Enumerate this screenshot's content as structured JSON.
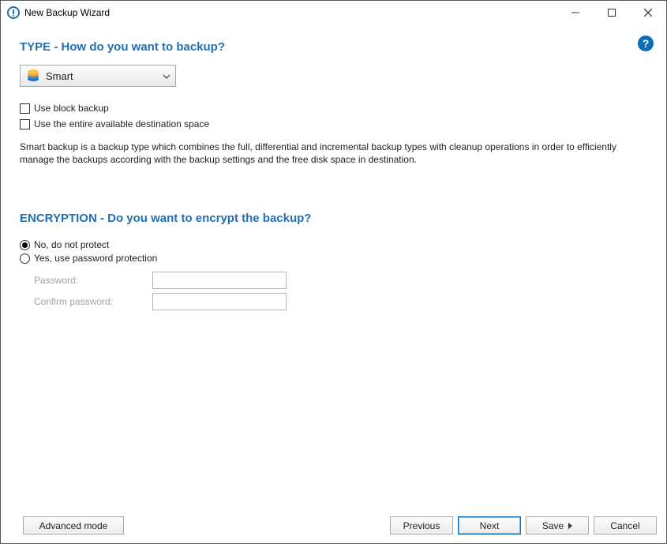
{
  "window": {
    "title": "New Backup Wizard"
  },
  "type_section": {
    "heading": "TYPE - How do you want to backup?",
    "selected": "Smart",
    "checkbox_block": "Use block backup",
    "checkbox_space": "Use the entire available destination space",
    "description": "Smart backup is a backup type which combines the full, differential and incremental backup types with cleanup operations in order to efficiently manage the backups according with the backup settings and the free disk space in destination."
  },
  "encryption_section": {
    "heading": "ENCRYPTION - Do you want to encrypt the backup?",
    "radio_no": "No, do not protect",
    "radio_yes": "Yes, use password protection",
    "password_label": "Password:",
    "confirm_label": "Confirm password:"
  },
  "footer": {
    "advanced": "Advanced mode",
    "previous": "Previous",
    "next": "Next",
    "save": "Save",
    "cancel": "Cancel"
  },
  "help": "?"
}
